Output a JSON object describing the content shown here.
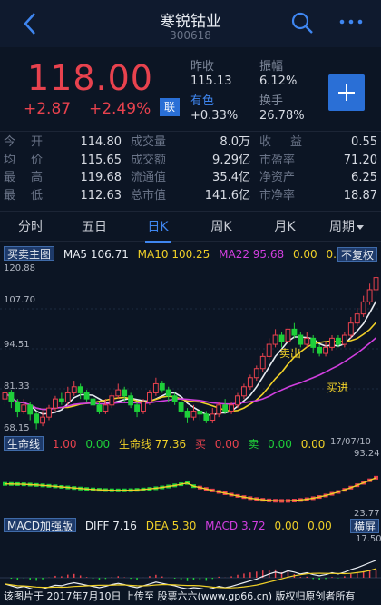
{
  "header": {
    "title": "寒锐钴业",
    "code": "300618"
  },
  "quote": {
    "price": "118.00",
    "change": "+2.87",
    "change_pct": "+2.49%",
    "rong": "联",
    "stats": [
      {
        "label": "昨收",
        "value": "115.13"
      },
      {
        "label": "振幅",
        "value": "6.12%"
      },
      {
        "label": "有色",
        "value": "+0.33%"
      },
      {
        "label": "换手",
        "value": "26.78%"
      }
    ]
  },
  "grid": [
    [
      "今",
      "开",
      "114.80",
      "成交量",
      "8.0万",
      "收",
      "益",
      "0.55"
    ],
    [
      "均",
      "价",
      "115.65",
      "成交额",
      "9.29亿",
      "市盈率",
      "",
      "71.20"
    ],
    [
      "最",
      "高",
      "119.68",
      "流通值",
      "35.4亿",
      "净资产",
      "",
      "6.25"
    ],
    [
      "最",
      "低",
      "112.63",
      "总市值",
      "141.6亿",
      "市净率",
      "",
      "18.87"
    ]
  ],
  "tabs": [
    "分时",
    "五日",
    "日K",
    "周K",
    "月K",
    "周期"
  ],
  "main_chart": {
    "indicator_button": "买卖主图",
    "ma5": "MA5 106.71",
    "ma10": "MA10 100.25",
    "ma22": "MA22 95.68",
    "z1": "0.00",
    "z2": "0.00",
    "fq_button": "不复权",
    "y_ticks": [
      "120.88",
      "107.70",
      "94.51",
      "81.33",
      "68.15"
    ],
    "sell_label": "卖出",
    "buy_label": "买进"
  },
  "life_chart": {
    "button": "生命线",
    "v1": "1.00",
    "v2": "0.00",
    "life": "生命线 77.36",
    "buy": "买",
    "v3": "0.00",
    "sell": "卖",
    "v4": "0.00",
    "v5": "0.00",
    "date": "17/07/10",
    "top": "93.24",
    "bottom": "23.77"
  },
  "macd_chart": {
    "button": "MACD加强版",
    "diff": "DIFF 7.16",
    "dea": "DEA 5.30",
    "macd": "MACD 3.72",
    "v1": "0.00",
    "v2": "0.00",
    "landscape": "横屏",
    "top": "17.50"
  },
  "footer": "该图片于 2017年7月10日 上传至 股票六六(www.gp66.cn) 版权归原创者所有",
  "colors": {
    "up": "#e8424e",
    "down": "#1fcf3a",
    "accent": "#2a6fd6",
    "bg": "#0c1524"
  },
  "candles": [
    [
      78,
      80,
      82,
      76
    ],
    [
      80,
      77,
      81,
      75
    ],
    [
      77,
      74,
      78,
      72
    ],
    [
      74,
      76,
      78,
      73
    ],
    [
      76,
      73,
      77,
      71
    ],
    [
      73,
      70,
      74,
      68
    ],
    [
      70,
      72,
      74,
      69
    ],
    [
      72,
      75,
      76,
      71
    ],
    [
      75,
      78,
      79,
      74
    ],
    [
      78,
      77,
      80,
      76
    ],
    [
      77,
      80,
      82,
      76
    ],
    [
      80,
      82,
      84,
      79
    ],
    [
      82,
      80,
      83,
      78
    ],
    [
      80,
      78,
      81,
      77
    ],
    [
      78,
      76,
      79,
      74
    ],
    [
      76,
      74,
      77,
      73
    ],
    [
      74,
      76,
      78,
      73
    ],
    [
      76,
      79,
      80,
      75
    ],
    [
      79,
      81,
      83,
      78
    ],
    [
      81,
      79,
      82,
      77
    ],
    [
      79,
      76,
      80,
      75
    ],
    [
      76,
      74,
      77,
      72
    ],
    [
      74,
      77,
      78,
      73
    ],
    [
      77,
      80,
      81,
      76
    ],
    [
      80,
      83,
      85,
      79
    ],
    [
      83,
      81,
      84,
      80
    ],
    [
      81,
      79,
      82,
      77
    ],
    [
      79,
      77,
      80,
      76
    ],
    [
      77,
      74,
      78,
      73
    ],
    [
      74,
      72,
      75,
      70
    ],
    [
      72,
      74,
      76,
      71
    ],
    [
      74,
      73,
      75,
      71
    ],
    [
      73,
      71,
      74,
      70
    ],
    [
      71,
      73,
      75,
      70
    ],
    [
      73,
      76,
      77,
      72
    ],
    [
      76,
      74,
      78,
      73
    ],
    [
      74,
      76,
      77,
      73
    ],
    [
      76,
      79,
      80,
      75
    ],
    [
      79,
      82,
      83,
      78
    ],
    [
      82,
      85,
      86,
      81
    ],
    [
      85,
      88,
      89,
      84
    ],
    [
      88,
      92,
      93,
      87
    ],
    [
      92,
      96,
      98,
      91
    ],
    [
      96,
      99,
      101,
      95
    ],
    [
      99,
      97,
      100,
      95
    ],
    [
      97,
      101,
      102,
      96
    ],
    [
      101,
      99,
      103,
      98
    ],
    [
      99,
      96,
      100,
      95
    ],
    [
      96,
      98,
      100,
      95
    ],
    [
      98,
      95,
      99,
      93
    ],
    [
      95,
      93,
      96,
      92
    ],
    [
      93,
      95,
      97,
      92
    ],
    [
      95,
      98,
      99,
      94
    ],
    [
      98,
      96,
      99,
      95
    ],
    [
      96,
      99,
      100,
      95
    ],
    [
      99,
      103,
      105,
      98
    ],
    [
      103,
      106,
      108,
      102
    ],
    [
      106,
      110,
      112,
      105
    ],
    [
      110,
      114,
      116,
      109
    ],
    [
      114,
      118,
      120,
      112
    ]
  ]
}
